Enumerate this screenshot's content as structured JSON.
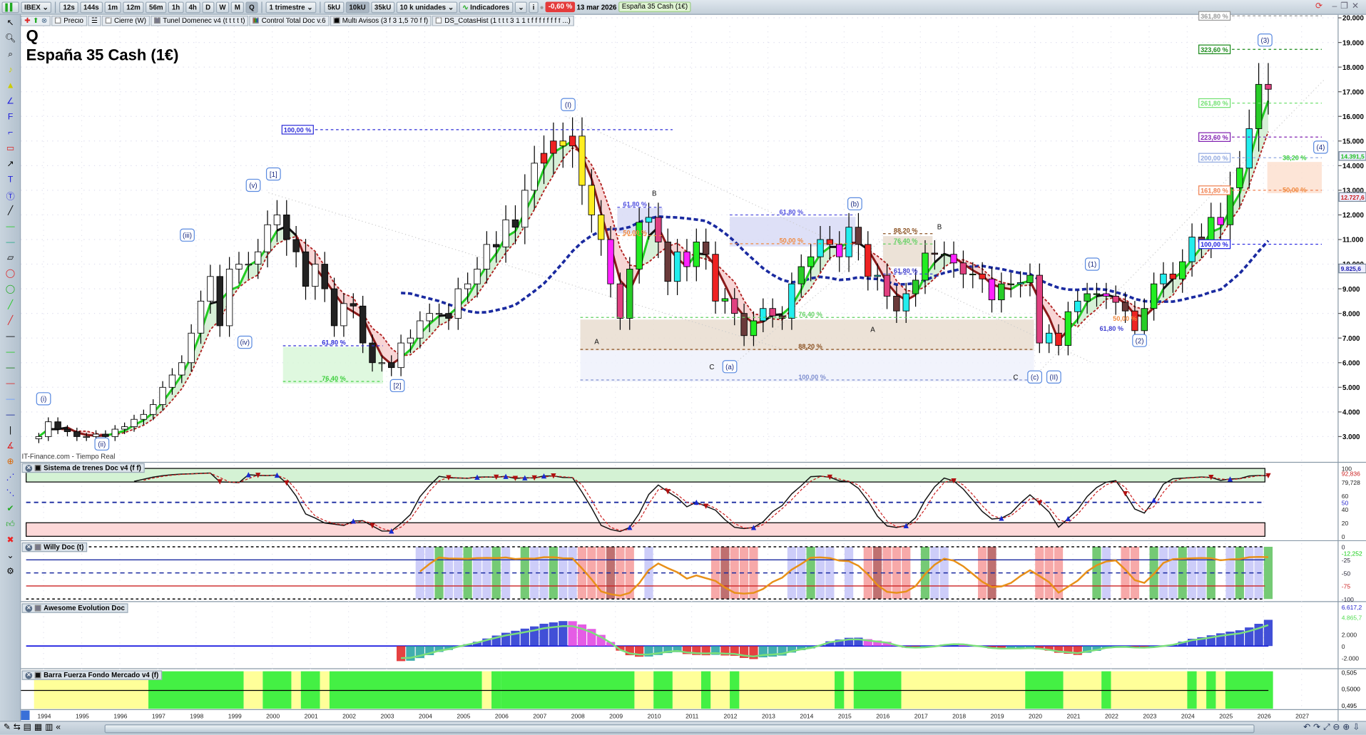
{
  "toolbar": {
    "symbol": "IBEX",
    "periods": [
      "12s",
      "144s",
      "1m",
      "12m",
      "56m",
      "1h",
      "4h",
      "D",
      "W",
      "M",
      "Q"
    ],
    "active_period": "Q",
    "timeframe": "1 trimestre",
    "units": [
      "5kU",
      "10kU",
      "35kU"
    ],
    "active_unit": "10kU",
    "units_select": "10 k unidades",
    "indicators_label": "Indicadores",
    "change": "-0,60 %",
    "date": "13 mar 2026",
    "instrument": "España 35 Cash (1€)"
  },
  "legend": {
    "items": [
      "Precio",
      "Cierre (W)",
      "Tunel Domenec v4 (t t t t t)",
      "Control Total Doc v.6",
      "Multi Avisos (3 f 3 1,5 70 f f)",
      "DS_CotasHist (1 t t t 3 1 1 t f f f f f f f f ...)"
    ]
  },
  "chart": {
    "period_letter": "Q",
    "title": "España 35 Cash (1€)",
    "source": "IT-Finance.com - Tiempo Real"
  },
  "panels": {
    "sistema": "Sistema de trenes Doc v4 (f f)",
    "willy": "Willy Doc (t)",
    "awesome": "Awesome Evolution Doc",
    "barra": "Barra Fuerza Fondo Mercado v4 (f)"
  },
  "axis": {
    "price_ticks": [
      "20.000",
      "19.000",
      "18.000",
      "17.000",
      "16.000",
      "15.000",
      "14.000",
      "13.000",
      "12.000",
      "11.000",
      "10.000",
      "9.000",
      "8.000",
      "7.000",
      "6.000",
      "5.000",
      "4.000",
      "3.000"
    ],
    "price_tags": [
      {
        "text": "14.391,5",
        "value": 14391.5,
        "color": "#1bbf1b"
      },
      {
        "text": "12.727,6",
        "value": 12727.6,
        "color": "#c81818"
      },
      {
        "text": "9.825,6",
        "value": 9825.6,
        "color": "#2020b0"
      }
    ],
    "sistema_ticks": [
      "100",
      "92,836",
      "79,728",
      "60",
      "50",
      "40",
      "20",
      "0"
    ],
    "willy_ticks": [
      "0",
      "-12,252",
      "-25",
      "-50",
      "-75",
      "-100"
    ],
    "awesome_ticks": [
      "6.617,2",
      "4.865,7",
      "2.000",
      "0",
      "-2.000"
    ],
    "barra_ticks": [
      "0,505",
      "0,5000",
      "0,495"
    ],
    "years": [
      "1994",
      "1995",
      "1996",
      "1997",
      "1998",
      "1999",
      "2000",
      "2001",
      "2002",
      "2003",
      "2004",
      "2005",
      "2006",
      "2007",
      "2008",
      "2009",
      "2010",
      "2011",
      "2012",
      "2013",
      "2014",
      "2015",
      "2016",
      "2017",
      "2018",
      "2019",
      "2020",
      "2021",
      "2022",
      "2023",
      "2024",
      "2025",
      "2026",
      "2027"
    ]
  },
  "chart_data": {
    "type": "candlestick",
    "start": 1993.75,
    "step": 0.25,
    "closes": [
      3000,
      3600,
      3300,
      3200,
      3000,
      3000,
      3100,
      3000,
      3300,
      3400,
      3700,
      3900,
      4300,
      5000,
      5500,
      6000,
      7200,
      8500,
      9500,
      7500,
      9800,
      10000,
      10000,
      10500,
      11600,
      12000,
      11000,
      10500,
      9100,
      10000,
      9000,
      7500,
      8400,
      8300,
      6800,
      6000,
      6000,
      5800,
      6800,
      7000,
      7700,
      8000,
      8000,
      7800,
      9000,
      9200,
      9800,
      10800,
      10700,
      11800,
      11500,
      13000,
      14100,
      14500,
      15000,
      14800,
      15200,
      13200,
      12000,
      11000,
      9200,
      7800,
      9800,
      11700,
      11900,
      10900,
      9300,
      10500,
      9900,
      10900,
      10400,
      8500,
      8600,
      8000,
      7100,
      7700,
      8200,
      7900,
      7800,
      9200,
      9900,
      10300,
      11000,
      10800,
      10300,
      11500,
      10800,
      9500,
      9550,
      8700,
      8100,
      8800,
      9350,
      10450,
      10400,
      10400,
      10050,
      9600,
      9600,
      9400,
      8550,
      9200,
      9200,
      9250,
      9550,
      6800,
      7200,
      6700,
      8070,
      8500,
      8800,
      8800,
      8700,
      8450,
      8100,
      7300,
      8200,
      9200,
      9600,
      9400,
      10100,
      11100,
      10900,
      11900,
      11600,
      13100,
      13900,
      15500,
      17300,
      17100
    ],
    "ylim": [
      2500,
      20000
    ],
    "wave_labels": [
      {
        "t": "(i)",
        "x": 1994.0,
        "y": 4535,
        "box": 1
      },
      {
        "t": "(ii)",
        "x": 1995.53,
        "y": 2700,
        "box": 1
      },
      {
        "t": "(iii)",
        "x": 1997.77,
        "y": 11180,
        "box": 1
      },
      {
        "t": "(iv)",
        "x": 1999.28,
        "y": 6830,
        "box": 1
      },
      {
        "t": "(v)",
        "x": 1999.5,
        "y": 13200,
        "box": 1
      },
      {
        "t": "[1]",
        "x": 2000.03,
        "y": 13660,
        "box": 1
      },
      {
        "t": "[2]",
        "x": 2003.28,
        "y": 5070,
        "box": 1
      },
      {
        "t": "(I)",
        "x": 2007.76,
        "y": 16480,
        "box": 1
      },
      {
        "t": "(a)",
        "x": 2012.0,
        "y": 5840,
        "box": 1
      },
      {
        "t": "(b)",
        "x": 2015.28,
        "y": 12450,
        "box": 1
      },
      {
        "t": "(c)",
        "x": 2020.0,
        "y": 5420,
        "box": 1
      },
      {
        "t": "(II)",
        "x": 2020.5,
        "y": 5420,
        "box": 1
      },
      {
        "t": "(1)",
        "x": 2021.51,
        "y": 10000,
        "box": 1
      },
      {
        "t": "(2)",
        "x": 2022.75,
        "y": 6900,
        "box": 1
      },
      {
        "t": "(3)",
        "x": 2026.04,
        "y": 19100,
        "box": 1
      },
      {
        "t": "(4)",
        "x": 2027.5,
        "y": 14750,
        "box": 1
      },
      {
        "t": "A",
        "x": 2008.51,
        "y": 6870,
        "box": 0
      },
      {
        "t": "B",
        "x": 2010.02,
        "y": 12880,
        "box": 0
      },
      {
        "t": "C",
        "x": 2011.53,
        "y": 5840,
        "box": 0
      },
      {
        "t": "A",
        "x": 2015.75,
        "y": 7360,
        "box": 0
      },
      {
        "t": "B",
        "x": 2017.5,
        "y": 11530,
        "box": 0
      },
      {
        "t": "C",
        "x": 2019.5,
        "y": 5420,
        "box": 0
      }
    ],
    "fib_zones": [
      {
        "x0": 2000.28,
        "x1": 2002.9,
        "y0": 6640,
        "y1": 5150,
        "fill": "#d9f7d9"
      },
      {
        "x0": 2008.08,
        "x1": 2019.98,
        "y0": 7750,
        "y1": 6500,
        "fill": "#e9ddd0"
      },
      {
        "x0": 2008.08,
        "x1": 2019.98,
        "y0": 6500,
        "y1": 5230,
        "fill": "#eef1fb"
      },
      {
        "x0": 2009.05,
        "x1": 2010.24,
        "y0": 12280,
        "y1": 11250,
        "fill": "#d8dbf6"
      },
      {
        "x0": 2012.0,
        "x1": 2015.3,
        "y0": 11920,
        "y1": 10720,
        "fill": "#d8dbf6"
      },
      {
        "x0": 2016.02,
        "x1": 2017.32,
        "y0": 11140,
        "y1": 9900,
        "fill": "#e9ddd0"
      },
      {
        "x0": 2026.1,
        "x1": 2027.53,
        "y0": 14150,
        "y1": 12880,
        "fill": "#fde0d0"
      }
    ],
    "fib_labels": [
      {
        "t": "100,00 %",
        "x": 2000.3,
        "y": 15460,
        "c": "#2d2dd8",
        "box": 1,
        "x1": 2010.5
      },
      {
        "t": "61,80 %",
        "x": 2001.3,
        "y": 6830,
        "c": "#2d2dd8",
        "x0": 2000.28,
        "x1": 2002.9
      },
      {
        "t": "76,40 %",
        "x": 2001.3,
        "y": 5380,
        "c": "#3ccf3c",
        "x0": 2000.28,
        "x1": 2002.9
      },
      {
        "t": "61,80 %",
        "x": 2009.2,
        "y": 12450,
        "c": "#5050e0",
        "x0": 2009.05,
        "x1": 2010.24
      },
      {
        "t": "50,00 %",
        "x": 2009.2,
        "y": 11300,
        "c": "#f08a40",
        "x0": 2009.05,
        "x1": 2010.24
      },
      {
        "t": "61,80 %",
        "x": 2013.3,
        "y": 12140,
        "c": "#5050e0",
        "x0": 2012.0,
        "x1": 2015.3
      },
      {
        "t": "50,00 %",
        "x": 2013.3,
        "y": 10970,
        "c": "#f08a40",
        "x0": 2012.0,
        "x1": 2015.3
      },
      {
        "t": "88,20 %",
        "x": 2016.3,
        "y": 11380,
        "c": "#8a5020",
        "x0": 2016.02,
        "x1": 2017.32
      },
      {
        "t": "76,40 %",
        "x": 2016.3,
        "y": 10960,
        "c": "#60d060",
        "x0": 2016.02,
        "x1": 2017.32
      },
      {
        "t": "61,80 %",
        "x": 2016.3,
        "y": 9740,
        "c": "#4040d0",
        "x0": 2016.02,
        "x1": 2017.32
      },
      {
        "t": "76,40 %",
        "x": 2013.8,
        "y": 7980,
        "c": "#60d060",
        "x0": 2008.08,
        "x1": 2019.98
      },
      {
        "t": "88,20 %",
        "x": 2013.8,
        "y": 6680,
        "c": "#8a5020",
        "x0": 2008.08,
        "x1": 2019.98
      },
      {
        "t": "100,00 %",
        "x": 2013.8,
        "y": 5440,
        "c": "#8090d0",
        "x0": 2008.08,
        "x1": 2019.98
      },
      {
        "t": "361,80 %",
        "x": 2024.35,
        "y": 20080,
        "c": "#999999",
        "box": 1,
        "x1": 2027.53
      },
      {
        "t": "323,60 %",
        "x": 2024.35,
        "y": 18720,
        "c": "#1a8a1a",
        "box": 1,
        "x1": 2027.53
      },
      {
        "t": "261,80 %",
        "x": 2024.35,
        "y": 16540,
        "c": "#70e070",
        "box": 1,
        "x1": 2027.53
      },
      {
        "t": "223,60 %",
        "x": 2024.35,
        "y": 15160,
        "c": "#8020b0",
        "box": 1,
        "x1": 2027.53
      },
      {
        "t": "200,00 %",
        "x": 2024.35,
        "y": 14320,
        "c": "#90a8e0",
        "box": 1,
        "x1": 2027.53
      },
      {
        "t": "161,80 %",
        "x": 2024.35,
        "y": 13000,
        "c": "#f08050",
        "box": 1,
        "x1": 2027.53
      },
      {
        "t": "100,00 %",
        "x": 2024.35,
        "y": 10810,
        "c": "#2020e0",
        "box": 1,
        "x1": 2027.53
      },
      {
        "t": "38,20 %",
        "x": 2026.5,
        "y": 14340,
        "c": "#3ccf3c"
      },
      {
        "t": "50,00 %",
        "x": 2026.5,
        "y": 13030,
        "c": "#f08a40"
      },
      {
        "t": "50,00 %",
        "x": 2022.05,
        "y": 7800,
        "c": "#f08a40"
      },
      {
        "t": "61,80 %",
        "x": 2021.7,
        "y": 7400,
        "c": "#4040d0"
      }
    ],
    "barra_segments": [
      [
        1993.75,
        1996.75,
        "#ffff99"
      ],
      [
        1996.75,
        1999.25,
        "#44f044"
      ],
      [
        1999.25,
        1999.75,
        "#ffff99"
      ],
      [
        1999.75,
        2000.5,
        "#44f044"
      ],
      [
        2000.5,
        2000.75,
        "#ffff99"
      ],
      [
        2000.75,
        2001.25,
        "#44f044"
      ],
      [
        2001.25,
        2001.5,
        "#ffff99"
      ],
      [
        2001.5,
        2005.5,
        "#44f044"
      ],
      [
        2005.5,
        2005.75,
        "#ffff99"
      ],
      [
        2005.75,
        2006.0,
        "#44f044"
      ],
      [
        2006.0,
        2009.5,
        "#44f044"
      ],
      [
        2009.5,
        2010.0,
        "#ffff99"
      ],
      [
        2010.0,
        2010.5,
        "#44f044"
      ],
      [
        2010.5,
        2011.25,
        "#ffff99"
      ],
      [
        2011.25,
        2011.5,
        "#44f044"
      ],
      [
        2011.5,
        2012.0,
        "#ffff99"
      ],
      [
        2012.0,
        2012.25,
        "#44f044"
      ],
      [
        2012.25,
        2014.75,
        "#ffff99"
      ],
      [
        2014.75,
        2015.0,
        "#44f044"
      ],
      [
        2015.0,
        2015.25,
        "#ffff99"
      ],
      [
        2015.25,
        2016.5,
        "#44f044"
      ],
      [
        2016.5,
        2019.75,
        "#ffff99"
      ],
      [
        2019.75,
        2020.75,
        "#44f044"
      ],
      [
        2020.75,
        2021.75,
        "#ffff99"
      ],
      [
        2021.75,
        2022.0,
        "#44f044"
      ],
      [
        2022.0,
        2024.0,
        "#ffff99"
      ],
      [
        2024.0,
        2024.25,
        "#44f044"
      ],
      [
        2024.25,
        2024.5,
        "#ffff99"
      ],
      [
        2024.5,
        2024.75,
        "#44f044"
      ],
      [
        2024.75,
        2025.0,
        "#ffff99"
      ],
      [
        2025.0,
        2026.25,
        "#44f044"
      ]
    ]
  }
}
